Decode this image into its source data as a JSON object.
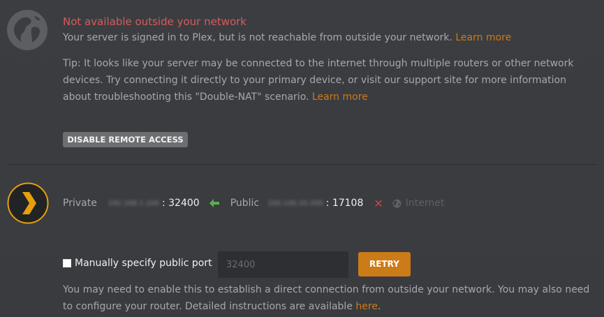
{
  "error": {
    "title": "Not available outside your network",
    "message": "Your server is signed in to Plex, but is not reachable from outside your network.",
    "message_link": "Learn more"
  },
  "tip": {
    "text": "Tip: It looks like your server may be connected to the internet through multiple routers or other network devices. Try connecting it directly to your primary device, or visit our support site for more information about troubleshooting this \"Double-NAT\" scenario.",
    "link": "Learn more"
  },
  "actions": {
    "disable_remote_access": "DISABLE REMOTE ACCESS",
    "retry": "RETRY"
  },
  "connection": {
    "private_label": "Private",
    "private_ip": "192.168.1.100",
    "private_port": ": 32400",
    "public_label": "Public",
    "public_ip": "100.100.20.200",
    "public_port": ": 17108",
    "internet_label": "Internet",
    "private_arrow_color": "#58b04f",
    "public_status_color": "#d64040"
  },
  "manual_port": {
    "checkbox_label": "Manually specify public port",
    "checked": false,
    "input_value": "",
    "input_placeholder": "32400"
  },
  "help": {
    "text": "You may need to enable this to establish a direct connection from outside your network. You may also need to configure your router. Detailed instructions are available",
    "link": "here",
    "suffix": "."
  },
  "icons": {
    "globe": "globe-icon",
    "plex": "plex-logo",
    "arrow": "arrow-left-icon",
    "x": "close-icon",
    "internet": "globe-small-icon"
  },
  "colors": {
    "accent": "#cc7b19",
    "error": "#d85b5b"
  }
}
